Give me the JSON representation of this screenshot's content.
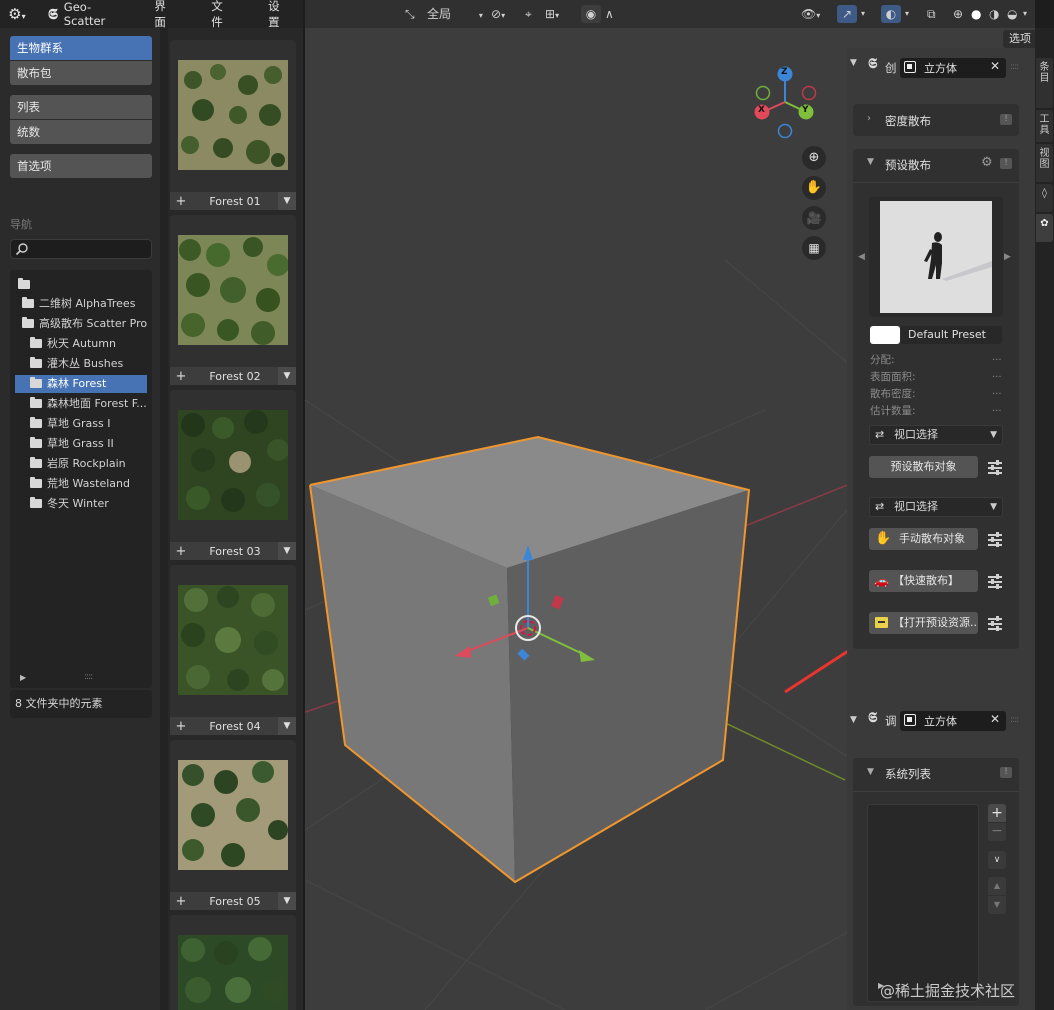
{
  "topbar": {
    "app_name": "Geo-Scatter",
    "menus": [
      "界面",
      "文件",
      "设置"
    ]
  },
  "left_nav": {
    "buttons": [
      "生物群系",
      "散布包",
      "列表",
      "统数",
      "首选项"
    ],
    "nav_label": "导航",
    "search_placeholder": ""
  },
  "tree": {
    "items": [
      "二维树 AlphaTrees",
      "高级散布 Scatter Pro",
      "秋天 Autumn",
      "灌木丛 Bushes",
      "森林 Forest",
      "森林地面 Forest F...",
      "草地 Grass I",
      "草地 Grass II",
      "岩原 Rockplain",
      "荒地 Wasteland",
      "冬天 Winter"
    ],
    "selected": "森林 Forest",
    "footer": "8 文件夹中的元素"
  },
  "thumbnails": [
    {
      "name": "Forest 01"
    },
    {
      "name": "Forest 02"
    },
    {
      "name": "Forest 03"
    },
    {
      "name": "Forest 04"
    },
    {
      "name": "Forest 05"
    },
    {
      "name": ""
    }
  ],
  "viewport_header": {
    "transform_space": "全局",
    "options_label": "选项"
  },
  "gizmo": {
    "x": "X",
    "y": "Y",
    "z": "Z"
  },
  "npanel": {
    "header1_title": "创",
    "header1_object": "立方体",
    "density_panel": "密度散布",
    "preset_panel": "预设散布",
    "preset_name": "Default Preset",
    "stats": [
      {
        "label": "分配:",
        "value": "..."
      },
      {
        "label": "表面面积:",
        "value": "..."
      },
      {
        "label": "散布密度:",
        "value": "..."
      },
      {
        "label": "估计数量:",
        "value": "..."
      }
    ],
    "viewport_select_1": "视口选择",
    "preset_scatter_button": "预设散布对象",
    "viewport_select_2": "视口选择",
    "manual_scatter_button": "手动散布对象",
    "quick_scatter_button": "【快速散布】",
    "open_assets_button": "【打开预设资源...",
    "header2_title": "调",
    "header2_object": "立方体",
    "system_list_panel": "系统列表"
  },
  "right_tabs": [
    "条目",
    "工具",
    "视图"
  ],
  "watermark": "@稀土掘金技术社区",
  "colors": {
    "accent_blue": "#4772b3",
    "selection_orange": "#f0962e",
    "arrow_red": "#e8352d",
    "axis_x": "#e04a5a",
    "axis_y": "#7fbf3b",
    "axis_z": "#3b86d6",
    "axis_line_red": "#a63646",
    "axis_line_green": "#7a9c2d"
  }
}
